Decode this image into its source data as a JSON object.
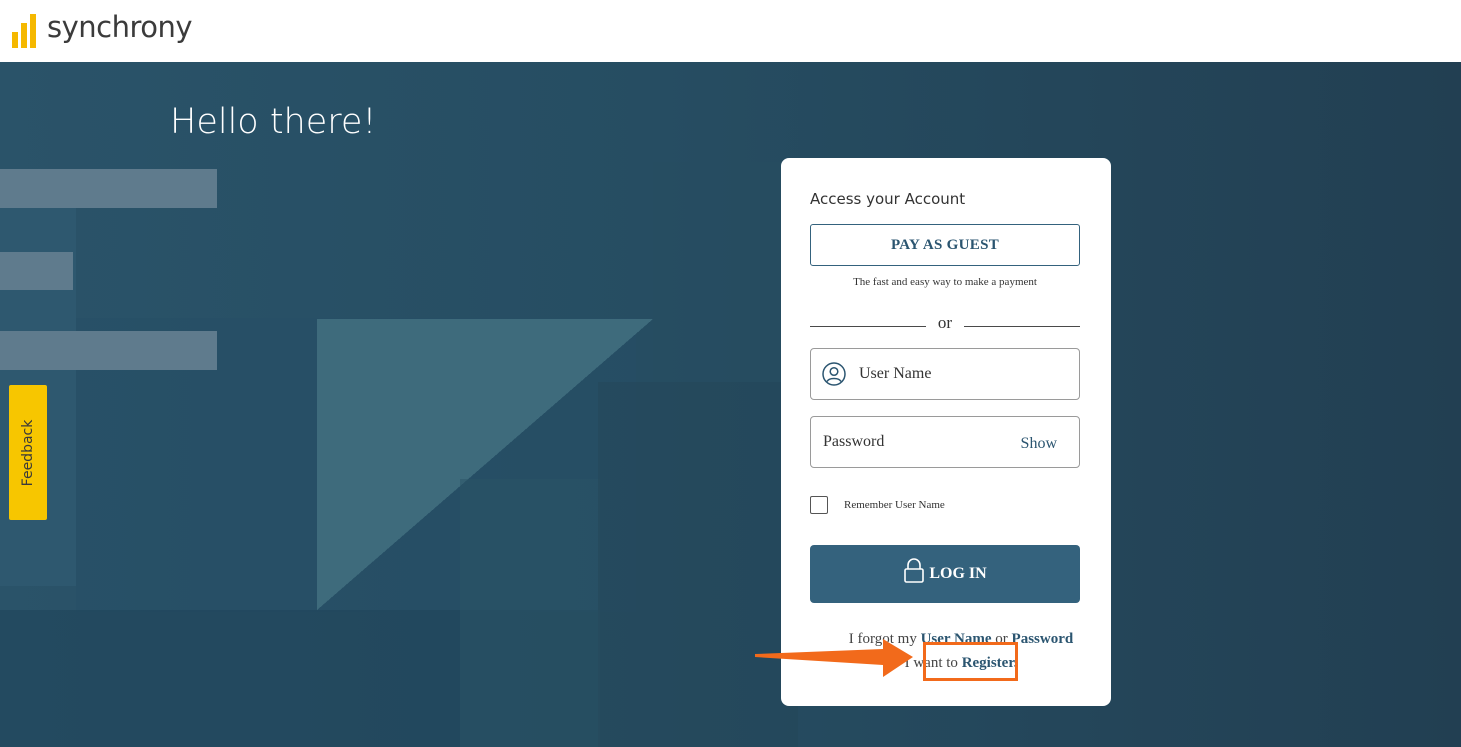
{
  "brand": {
    "name": "synchrony",
    "bar_color": "#f5b800"
  },
  "hero": {
    "greeting": "Hello there!"
  },
  "feedback": {
    "label": "Feedback"
  },
  "login_card": {
    "title": "Access your Account",
    "guest_button": "PAY AS GUEST",
    "guest_subtext": "The fast and easy way to make a payment",
    "divider_text": "or",
    "username_placeholder": "User Name",
    "password_placeholder": "Password",
    "show_label": "Show",
    "remember_label": "Remember User Name",
    "login_button": "LOG IN",
    "forgot_prefix": "I forgot my",
    "forgot_username": "User Name",
    "forgot_or": "or",
    "forgot_password": "Password",
    "register_prefix": "I want to",
    "register_link": "Register."
  },
  "colors": {
    "accent": "#34627d",
    "highlight": "#f26a1b",
    "feedback": "#f7c600"
  }
}
